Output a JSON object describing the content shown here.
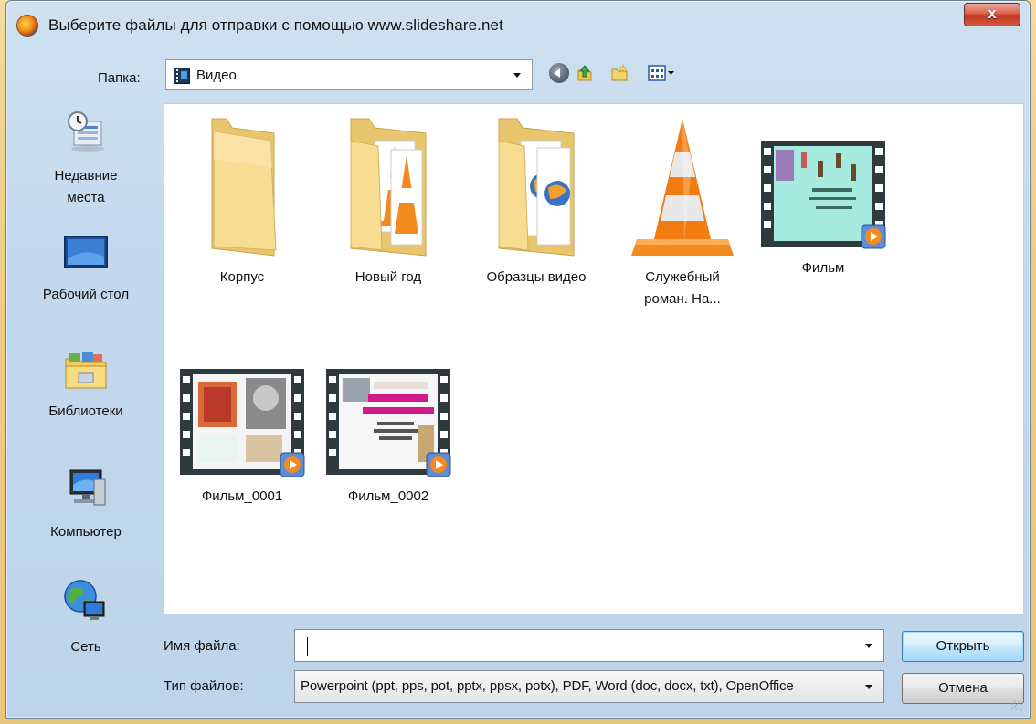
{
  "window": {
    "title": "Выберите файлы для отправки с помощью www.slideshare.net",
    "close_label": "x"
  },
  "toolbar": {
    "folder_label": "Папка:",
    "folder_value": "Видео",
    "icons": [
      "back-icon",
      "up-folder-icon",
      "new-folder-icon",
      "view-menu-icon"
    ]
  },
  "places": [
    {
      "label": "Недавние места",
      "icon": "recent-places-icon"
    },
    {
      "label": "Рабочий стол",
      "icon": "desktop-icon"
    },
    {
      "label": "Библиотеки",
      "icon": "libraries-icon"
    },
    {
      "label": "Компьютер",
      "icon": "computer-icon"
    },
    {
      "label": "Сеть",
      "icon": "network-icon"
    }
  ],
  "files": [
    {
      "name": "Корпус",
      "kind": "folder"
    },
    {
      "name": "Новый год",
      "kind": "folder-vlc"
    },
    {
      "name": "Образцы видео",
      "kind": "folder-media"
    },
    {
      "name": "Служебный роман. На...",
      "kind": "vlc-cone"
    },
    {
      "name": "Фильм",
      "kind": "video"
    },
    {
      "name": "Фильм_0001",
      "kind": "video"
    },
    {
      "name": "Фильм_0002",
      "kind": "video"
    }
  ],
  "bottom": {
    "filename_label": "Имя файла:",
    "filename_value": "",
    "filetype_label": "Тип файлов:",
    "filetype_value": "Powerpoint (ppt, pps, pot, pptx, ppsx, potx), PDF, Word (doc, docx, txt), OpenOffice",
    "open_label": "Открыть",
    "cancel_label": "Отмена"
  },
  "colors": {
    "background": "#eccf86",
    "dialog_frame": "#c3d8ec",
    "close_button": "#c8432c",
    "open_button": "#bee6fd"
  }
}
